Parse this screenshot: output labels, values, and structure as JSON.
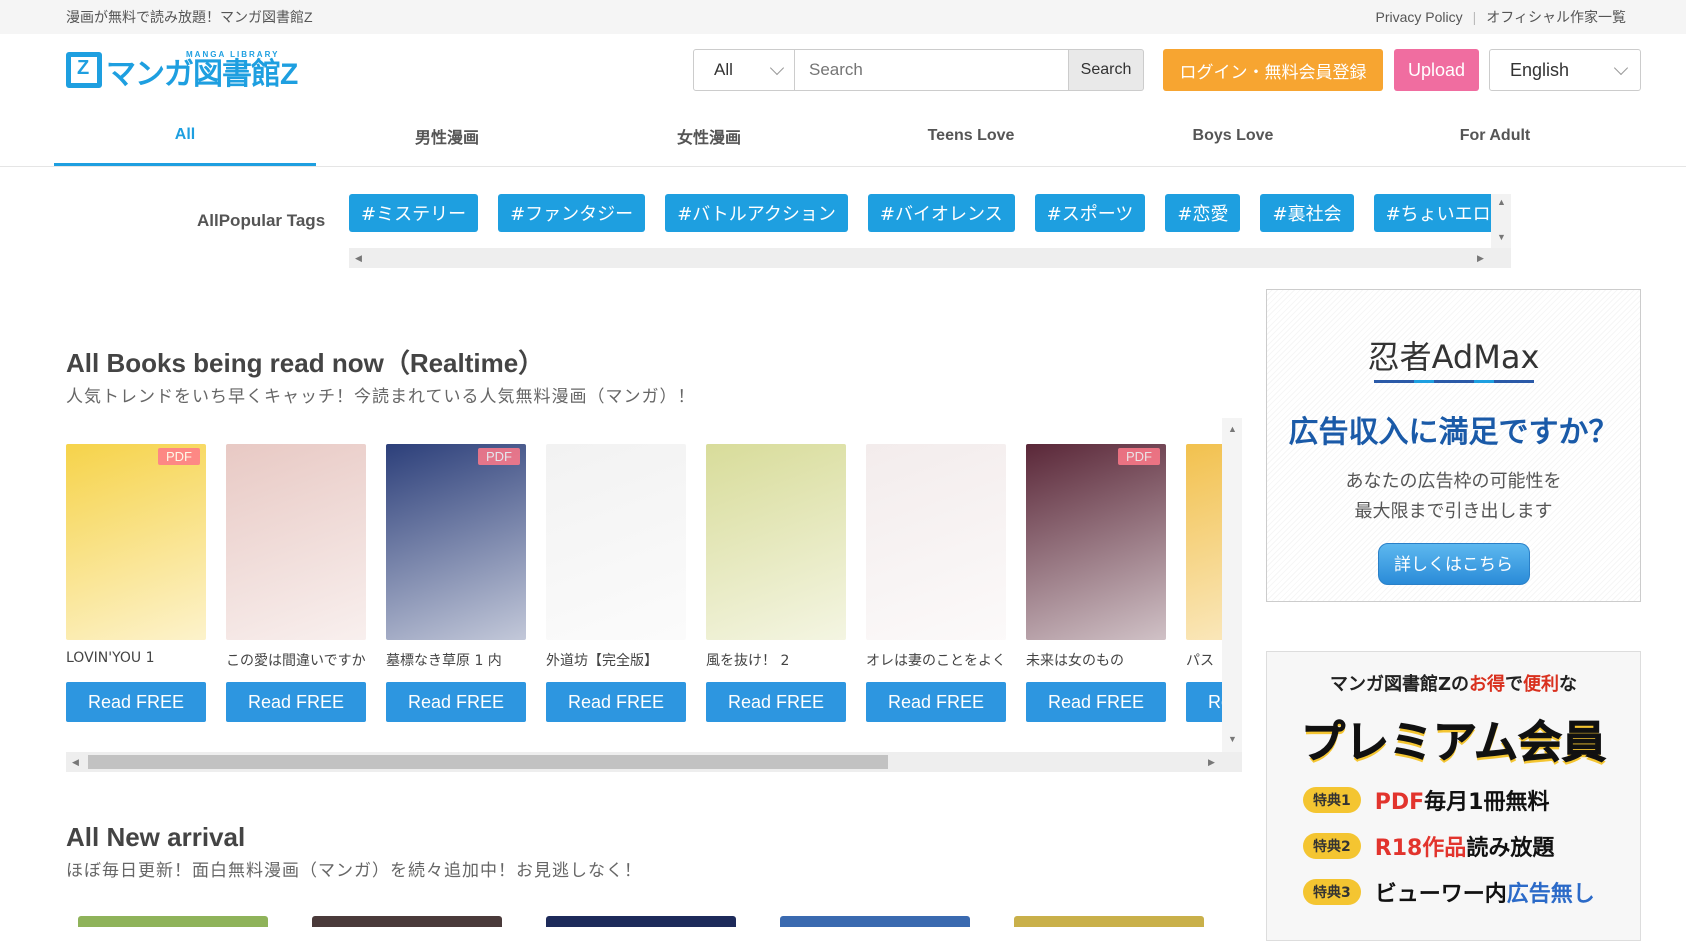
{
  "topbar": {
    "tagline": "漫画が無料で読み放題！マンガ図書館Z",
    "privacy": "Privacy Policy",
    "separator": "|",
    "authors": "オフィシャル作家一覧"
  },
  "header": {
    "logo_sub": "MANGA LIBRARY",
    "logo_text": "マンガ図書館Z",
    "search_scope": "All",
    "search_placeholder": "Search",
    "search_button": "Search",
    "login_button": "ログイン・無料会員登録",
    "upload_button": "Upload",
    "language": "English"
  },
  "nav": {
    "tabs": [
      {
        "label": "All",
        "active": true
      },
      {
        "label": "男性漫画"
      },
      {
        "label": "女性漫画"
      },
      {
        "label": "Teens Love"
      },
      {
        "label": "Boys Love"
      },
      {
        "label": "For Adult"
      }
    ]
  },
  "tags": {
    "label": "AllPopular Tags",
    "items": [
      "#ミステリー",
      "#ファンタジー",
      "#バトルアクション",
      "#バイオレンス",
      "#スポーツ",
      "#恋愛",
      "#裏社会",
      "#ちょいエロ"
    ]
  },
  "realtime": {
    "title": "All Books being read now（Realtime）",
    "subtitle": "人気トレンドをいち早くキャッチ！今読まれている人気無料漫画（マンガ）！",
    "read_label": "Read FREE",
    "pdf_label": "PDF",
    "books": [
      {
        "title": "LOVIN'YOU 1",
        "pdf": true,
        "color": "#f6d34a"
      },
      {
        "title": "この愛は間違いですか",
        "pdf": false,
        "color": "#e8c9c4"
      },
      {
        "title": "墓標なき草原 1 内",
        "pdf": true,
        "color": "#2c3f7a"
      },
      {
        "title": "外道坊【完全版】",
        "pdf": false,
        "color": "#f2f2f2"
      },
      {
        "title": "風を抜け！ 2",
        "pdf": false,
        "color": "#d8dc9a"
      },
      {
        "title": "オレは妻のことをよく",
        "pdf": false,
        "color": "#f3ecec"
      },
      {
        "title": "未来は女のもの",
        "pdf": true,
        "color": "#5a2738"
      },
      {
        "title": "パス",
        "pdf": false,
        "color": "#f2c14e"
      }
    ]
  },
  "new_arrival": {
    "title": "All New arrival",
    "subtitle": "ほぼ毎日更新！面白無料漫画（マンガ）を続々追加中！お見逃しなく！"
  },
  "ad_admax": {
    "brand": "忍者AdMax",
    "headline": "広告収入に満足ですか？",
    "copy_line1": "あなたの広告枠の可能性を",
    "copy_line2": "最大限まで引き出します",
    "cta": "詳しくはこちら"
  },
  "ad_premium": {
    "top_a": "マンガ図書館Zの",
    "top_b": "お得",
    "top_c": "で",
    "top_d": "便利",
    "top_e": "な",
    "big": "プレミアム会員",
    "perks": [
      {
        "badge": "特典1",
        "hl": "PDF",
        "rest": "毎月1冊無料"
      },
      {
        "badge": "特典2",
        "hl": "R18作品",
        "rest": "読み放題"
      },
      {
        "badge": "特典3",
        "pre": "ビューワー内",
        "hl": "広告無し"
      }
    ]
  }
}
